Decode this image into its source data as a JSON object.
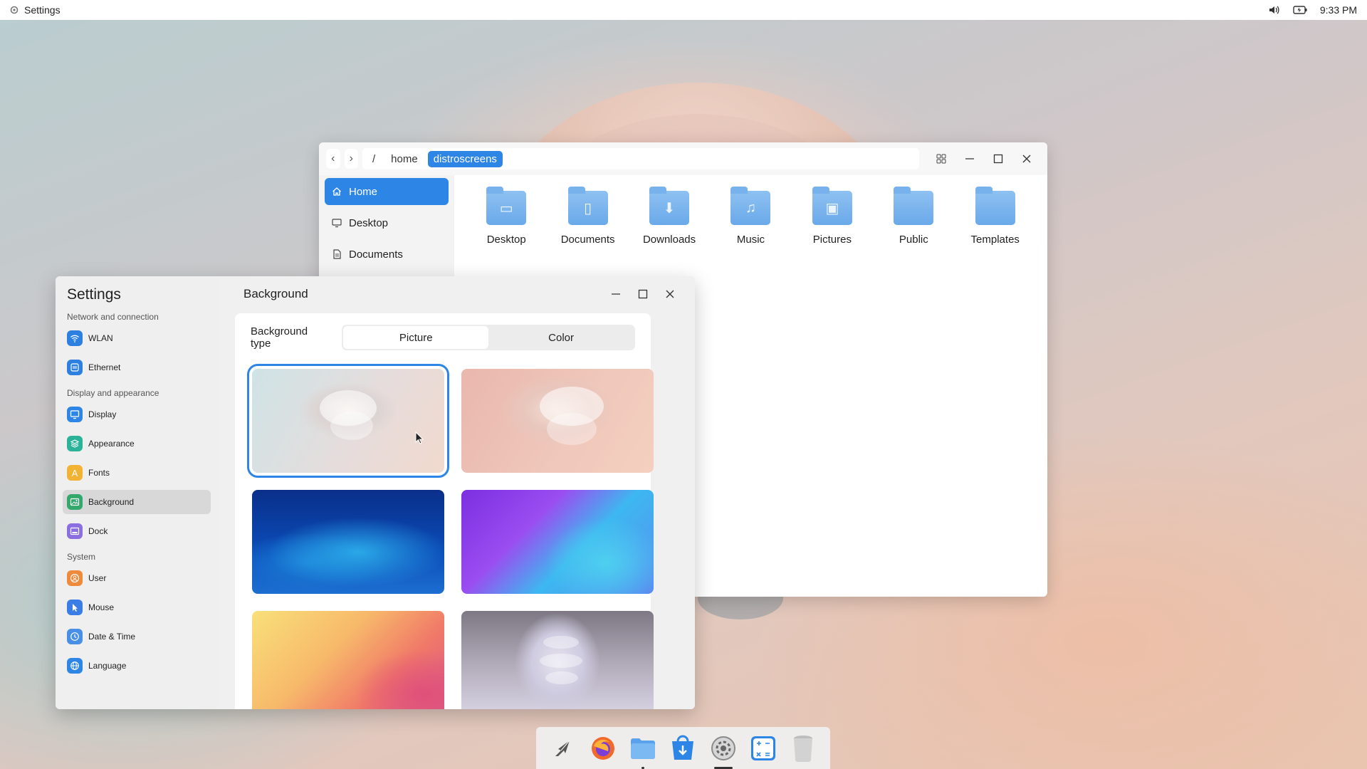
{
  "topbar": {
    "app_title": "Settings",
    "time": "9:33 PM",
    "icons": [
      "settings-gear-icon",
      "volume-icon",
      "battery-icon"
    ]
  },
  "file_manager": {
    "breadcrumb": {
      "root": "/",
      "items": [
        "home",
        "distroscreens"
      ]
    },
    "sidebar": [
      {
        "label": "Home",
        "icon": "home-icon",
        "selected": true
      },
      {
        "label": "Desktop",
        "icon": "monitor-icon"
      },
      {
        "label": "Documents",
        "icon": "document-icon"
      }
    ],
    "folders": [
      {
        "label": "Desktop",
        "icon": "desktop-folder-icon"
      },
      {
        "label": "Documents",
        "icon": "documents-folder-icon"
      },
      {
        "label": "Downloads",
        "icon": "downloads-folder-icon"
      },
      {
        "label": "Music",
        "icon": "music-folder-icon"
      },
      {
        "label": "Pictures",
        "icon": "pictures-folder-icon"
      },
      {
        "label": "Public",
        "icon": "public-folder-icon"
      },
      {
        "label": "Templates",
        "icon": "templates-folder-icon"
      }
    ]
  },
  "settings": {
    "title": "Settings",
    "page_title": "Background",
    "groups": [
      {
        "label": "Network and connection",
        "items": [
          {
            "label": "WLAN",
            "icon": "wifi-icon",
            "color": "#2d7fe0"
          },
          {
            "label": "Ethernet",
            "icon": "ethernet-icon",
            "color": "#2d7fe0"
          }
        ]
      },
      {
        "label": "Display and appearance",
        "items": [
          {
            "label": "Display",
            "icon": "display-icon",
            "color": "#2d86e6"
          },
          {
            "label": "Appearance",
            "icon": "appearance-icon",
            "color": "#2bb39a"
          },
          {
            "label": "Fonts",
            "icon": "fonts-icon",
            "color": "#f2b233"
          },
          {
            "label": "Background",
            "icon": "background-icon",
            "color": "#33a86b",
            "selected": true
          },
          {
            "label": "Dock",
            "icon": "dock-icon",
            "color": "#8b6fe0"
          }
        ]
      },
      {
        "label": "System",
        "items": [
          {
            "label": "User",
            "icon": "user-icon",
            "color": "#ef8a3c"
          },
          {
            "label": "Mouse",
            "icon": "mouse-icon",
            "color": "#3b7de6"
          },
          {
            "label": "Date & Time",
            "icon": "clock-icon",
            "color": "#4a8fe6"
          },
          {
            "label": "Language",
            "icon": "globe-icon",
            "color": "#2d86e6"
          }
        ]
      }
    ],
    "background_type": {
      "label": "Background type",
      "options": [
        "Picture",
        "Color"
      ],
      "selected": "Picture"
    },
    "wallpapers": [
      {
        "name": "wallpaper-sculpture-teal",
        "selected": true
      },
      {
        "name": "wallpaper-sculpture-pink"
      },
      {
        "name": "wallpaper-blue-waves"
      },
      {
        "name": "wallpaper-purple-cyan"
      },
      {
        "name": "wallpaper-yellow-coral"
      },
      {
        "name": "wallpaper-sculpture-grey"
      }
    ]
  },
  "dock": {
    "apps": [
      {
        "name": "launcher-icon"
      },
      {
        "name": "firefox-icon"
      },
      {
        "name": "file-manager-icon",
        "running": true
      },
      {
        "name": "app-store-icon"
      },
      {
        "name": "settings-icon",
        "active": true
      },
      {
        "name": "calculator-icon"
      },
      {
        "name": "trash-icon"
      }
    ]
  },
  "colors": {
    "accent": "#2d86e6"
  }
}
